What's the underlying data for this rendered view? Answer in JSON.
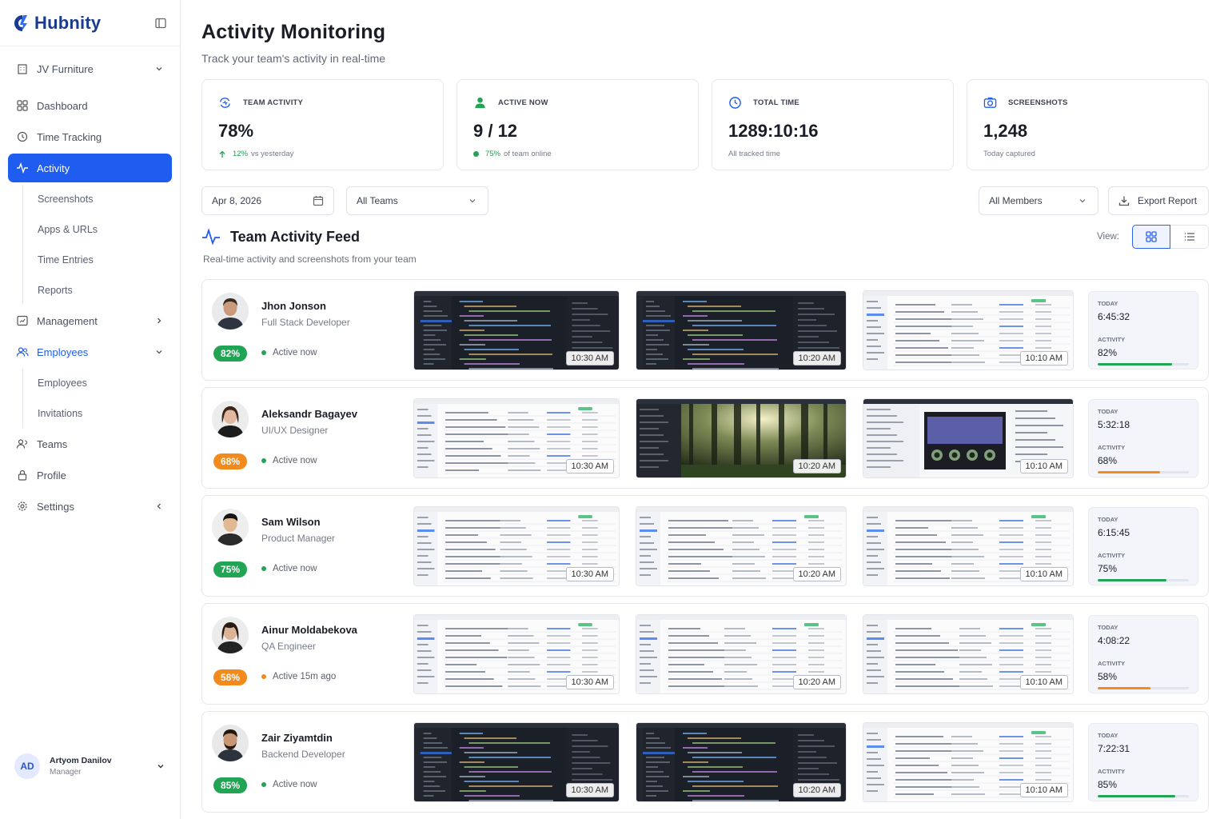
{
  "app": {
    "name": "Hubnity"
  },
  "sidebar": {
    "workspace": "JV Furniture",
    "items": {
      "dashboard": "Dashboard",
      "time_tracking": "Time Tracking",
      "activity": "Activity",
      "screenshots": "Screenshots",
      "apps_urls": "Apps & URLs",
      "time_entries": "Time Entries",
      "reports": "Reports",
      "management": "Management",
      "employees": "Employees",
      "employees_sub": "Employees",
      "invitations": "Invitations",
      "teams": "Teams",
      "profile": "Profile",
      "settings": "Settings"
    },
    "user": {
      "initials": "AD",
      "name": "Artyom Danilov",
      "role": "Manager"
    }
  },
  "header": {
    "title": "Activity Monitoring",
    "subtitle": "Track your team's activity in real-time"
  },
  "stats": [
    {
      "label": "TEAM ACTIVITY",
      "value": "78%",
      "note_highlight": "12%",
      "note": "vs yesterday",
      "icon": "refresh-activity-icon"
    },
    {
      "label": "ACTIVE NOW",
      "value": "9 / 12",
      "note_highlight": "75%",
      "note": "of team online",
      "icon": "user-icon"
    },
    {
      "label": "TOTAL TIME",
      "value": "1289:10:16",
      "note": "All tracked time",
      "icon": "clock-icon"
    },
    {
      "label": "SCREENSHOTS",
      "value": "1,248",
      "note": "Today captured",
      "icon": "camera-icon"
    }
  ],
  "filters": {
    "date": "Apr 8, 2026",
    "teams": "All Teams",
    "members": "All Members",
    "export": "Export Report"
  },
  "feed": {
    "title": "Team Activity Feed",
    "subtitle": "Real-time activity and screenshots from your team",
    "view_label": "View:"
  },
  "summary_labels": {
    "today": "TODAY",
    "activity": "ACTIVITY"
  },
  "colors": {
    "primary": "#1f5cf0",
    "green": "#21a454",
    "orange": "#f28a1c"
  },
  "members": [
    {
      "name": "Jhon Jonson",
      "role": "Full Stack Developer",
      "percent": "82%",
      "status": "Active now",
      "times": [
        "10:30 AM",
        "10:20 AM",
        "10:10 AM"
      ],
      "today": "6:45:32",
      "activity": "82%",
      "activity_level": 0.82
    },
    {
      "name": "Aleksandr Bagayev",
      "role": "UI/UX Designer",
      "percent": "68%",
      "status": "Active now",
      "times": [
        "10:30 AM",
        "10:20 AM",
        "10:10 AM"
      ],
      "today": "5:32:18",
      "activity": "68%",
      "activity_level": 0.68
    },
    {
      "name": "Sam Wilson",
      "role": "Product Manager",
      "percent": "75%",
      "status": "Active now",
      "times": [
        "10:30 AM",
        "10:20 AM",
        "10:10 AM"
      ],
      "today": "6:15:45",
      "activity": "75%",
      "activity_level": 0.75
    },
    {
      "name": "Ainur Moldabekova",
      "role": "QA Engineer",
      "percent": "58%",
      "status": "Active 15m ago",
      "times": [
        "10:30 AM",
        "10:20 AM",
        "10:10 AM"
      ],
      "today": "4:08:22",
      "activity": "58%",
      "activity_level": 0.58
    },
    {
      "name": "Zair Ziyamtdin",
      "role": "Backend Developer",
      "percent": "85%",
      "status": "Active now",
      "times": [
        "10:30 AM",
        "10:20 AM",
        "10:10 AM"
      ],
      "today": "7:22:31",
      "activity": "85%",
      "activity_level": 0.85
    }
  ]
}
